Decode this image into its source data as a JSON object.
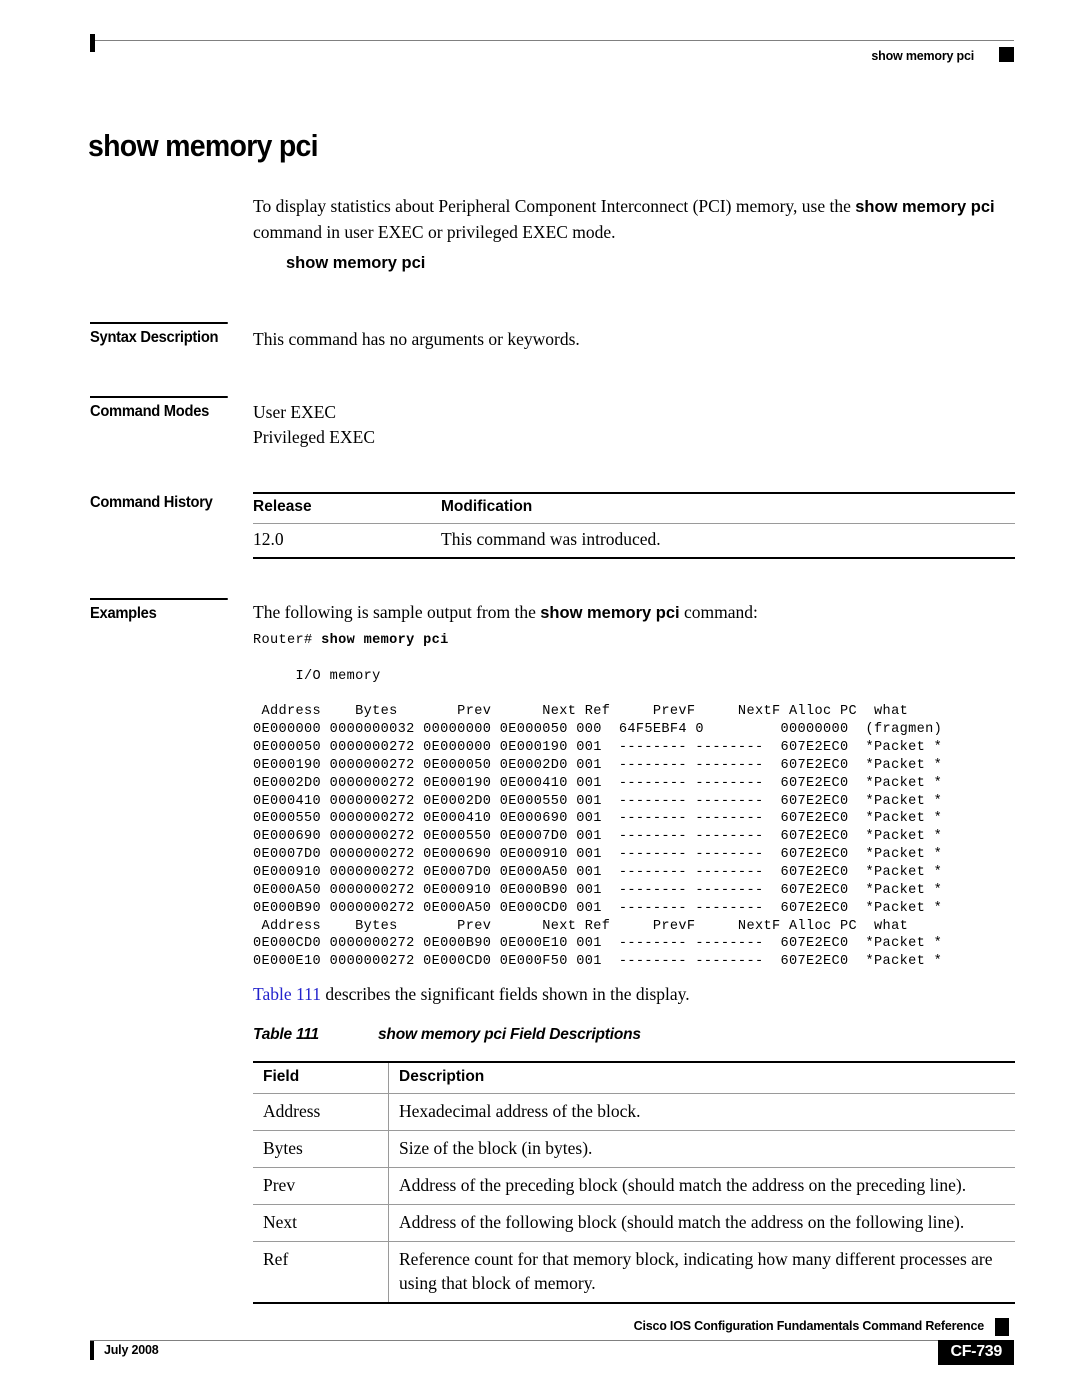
{
  "header": {
    "running_title": "show memory pci",
    "marker_icon": "black-square-marker"
  },
  "command": {
    "title": "show memory pci",
    "description_pre": "To display statistics about Peripheral Component Interconnect (PCI) memory, use the ",
    "description_bold": "show memory pci",
    "description_post": " command in user EXEC or privileged EXEC mode.",
    "syntax_line": "show memory pci"
  },
  "sections": {
    "syntax_description": {
      "label": "Syntax Description",
      "text": "This command has no arguments or keywords."
    },
    "command_modes": {
      "label": "Command Modes",
      "mode_1": "User EXEC",
      "mode_2": "Privileged EXEC"
    },
    "command_history": {
      "label": "Command History",
      "headers": {
        "release": "Release",
        "modification": "Modification"
      },
      "rows": [
        {
          "release": "12.0",
          "modification": "This command was introduced."
        }
      ]
    },
    "examples": {
      "label": "Examples",
      "intro_pre": "The following is sample output from the ",
      "intro_bold": "show memory pci",
      "intro_post": " command:"
    }
  },
  "code_output": {
    "prompt": "Router# ",
    "command_echo": "show memory pci",
    "lines": [
      "",
      "     I/O memory",
      "",
      " Address    Bytes       Prev      Next Ref     PrevF     NextF Alloc PC  what",
      "0E000000 0000000032 00000000 0E000050 000  64F5EBF4 0         00000000  (fragmen)",
      "0E000050 0000000272 0E000000 0E000190 001  -------- --------  607E2EC0  *Packet *",
      "0E000190 0000000272 0E000050 0E0002D0 001  -------- --------  607E2EC0  *Packet *",
      "0E0002D0 0000000272 0E000190 0E000410 001  -------- --------  607E2EC0  *Packet *",
      "0E000410 0000000272 0E0002D0 0E000550 001  -------- --------  607E2EC0  *Packet *",
      "0E000550 0000000272 0E000410 0E000690 001  -------- --------  607E2EC0  *Packet *",
      "0E000690 0000000272 0E000550 0E0007D0 001  -------- --------  607E2EC0  *Packet *",
      "0E0007D0 0000000272 0E000690 0E000910 001  -------- --------  607E2EC0  *Packet *",
      "0E000910 0000000272 0E0007D0 0E000A50 001  -------- --------  607E2EC0  *Packet *",
      "0E000A50 0000000272 0E000910 0E000B90 001  -------- --------  607E2EC0  *Packet *",
      "0E000B90 0000000272 0E000A50 0E000CD0 001  -------- --------  607E2EC0  *Packet *",
      " Address    Bytes       Prev      Next Ref     PrevF     NextF Alloc PC  what",
      "0E000CD0 0000000272 0E000B90 0E000E10 001  -------- --------  607E2EC0  *Packet *",
      "0E000E10 0000000272 0E000CD0 0E000F50 001  -------- --------  607E2EC0  *Packet *"
    ]
  },
  "table_intro": {
    "xref": "Table 111",
    "text": " describes the significant fields shown in the display."
  },
  "field_table": {
    "caption_number": "Table 111",
    "caption_title": "show memory pci Field Descriptions",
    "headers": {
      "field": "Field",
      "description": "Description"
    },
    "rows": [
      {
        "field": "Address",
        "description": "Hexadecimal address of the block."
      },
      {
        "field": "Bytes",
        "description": "Size of the block (in bytes)."
      },
      {
        "field": "Prev",
        "description": "Address of the preceding block (should match the address on the preceding line)."
      },
      {
        "field": "Next",
        "description": "Address of the following block (should match the address on the following line)."
      },
      {
        "field": "Ref",
        "description": "Reference count for that memory block, indicating how many different processes are using that block of memory."
      }
    ]
  },
  "footer": {
    "book_title": "Cisco IOS Configuration Fundamentals Command Reference",
    "date": "July 2008",
    "page_number": "CF-739",
    "marker_icon": "black-square-marker"
  },
  "colors": {
    "xref_blue": "#2222cc",
    "rule_gray": "#808080",
    "text_black": "#000000"
  }
}
